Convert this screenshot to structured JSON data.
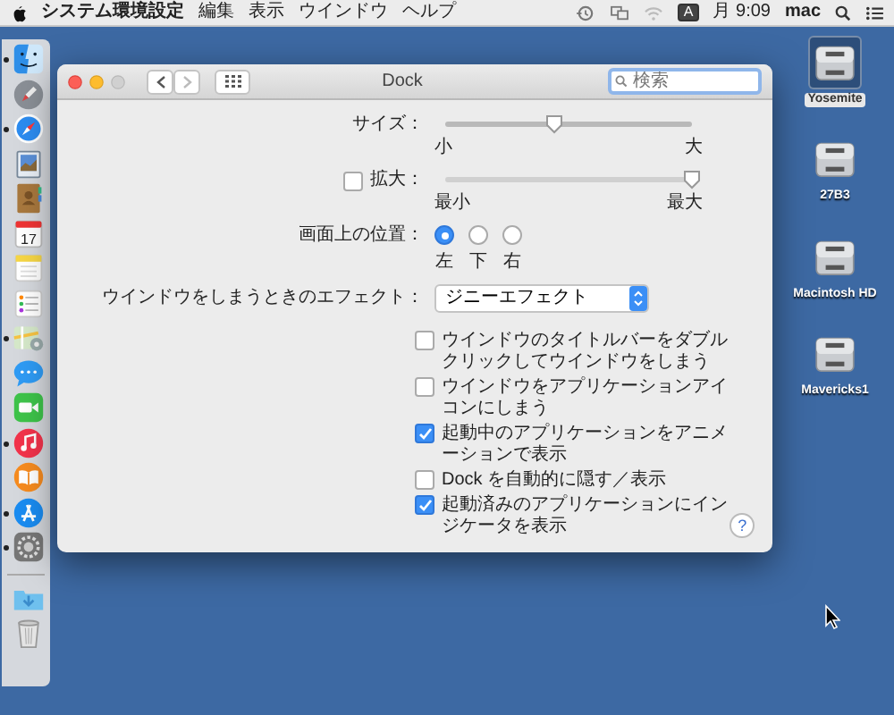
{
  "menu_bar": {
    "app_name": "システム環境設定",
    "menus": [
      "編集",
      "表示",
      "ウインドウ",
      "ヘルプ"
    ],
    "input_source": "A",
    "clock": "月 9:09",
    "user": "mac"
  },
  "dock": {
    "apps": [
      {
        "kind": "finder",
        "running": true
      },
      {
        "kind": "launchpad",
        "running": false
      },
      {
        "kind": "safari",
        "running": true
      },
      {
        "kind": "preview",
        "running": false
      },
      {
        "kind": "contacts",
        "running": false
      },
      {
        "kind": "calendar",
        "running": false,
        "label": "17"
      },
      {
        "kind": "notes",
        "running": false
      },
      {
        "kind": "reminders",
        "running": false
      },
      {
        "kind": "maps",
        "running": true
      },
      {
        "kind": "messages",
        "running": false
      },
      {
        "kind": "facetime",
        "running": false
      },
      {
        "kind": "music",
        "running": true
      },
      {
        "kind": "books",
        "running": false
      },
      {
        "kind": "appstore",
        "running": true
      },
      {
        "kind": "settings",
        "running": true
      }
    ],
    "stacks": [
      {
        "kind": "downloads"
      },
      {
        "kind": "trash"
      }
    ]
  },
  "window": {
    "title": "Dock",
    "search": {
      "placeholder": "検索"
    },
    "size": {
      "label": "サイズ：",
      "level": 0.44,
      "min_label": "小",
      "max_label": "大"
    },
    "magnification": {
      "label": "拡大：",
      "checked": false,
      "level": 1,
      "min_label": "最小",
      "max_label": "最大"
    },
    "position": {
      "label": "画面上の位置：",
      "options": [
        {
          "label": "左",
          "selected": true
        },
        {
          "label": "下",
          "selected": false
        },
        {
          "label": "右",
          "selected": false
        }
      ]
    },
    "effect": {
      "label": "ウインドウをしまうときのエフェクト：",
      "value": "ジニーエフェクト"
    },
    "options": [
      {
        "label": "ウインドウのタイトルバーをダブルクリックしてウインドウをしまう",
        "checked": false
      },
      {
        "label": "ウインドウをアプリケーションアイコンにしまう",
        "checked": false
      },
      {
        "label": "起動中のアプリケーションをアニメーションで表示",
        "checked": true
      },
      {
        "label": "Dock を自動的に隠す／表示",
        "checked": false
      },
      {
        "label": "起動済みのアプリケーションにインジケータを表示",
        "checked": true
      }
    ],
    "help": "?"
  },
  "desktop_icons": [
    {
      "label": "Yosemite",
      "selected": true
    },
    {
      "label": "27B3",
      "selected": false
    },
    {
      "label": "Macintosh HD",
      "selected": false
    },
    {
      "label": "Mavericks1",
      "selected": false
    }
  ]
}
